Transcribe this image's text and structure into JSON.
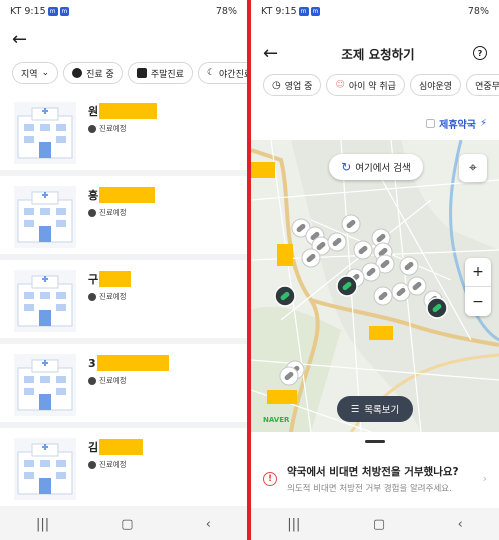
{
  "left": {
    "status": {
      "carrier": "KT 9:15",
      "battery": "78%"
    },
    "filters": [
      "지역",
      "진료 중",
      "주말진료",
      "야간진료"
    ],
    "items": [
      {
        "initial": "원",
        "status": "진료예정"
      },
      {
        "initial": "흥",
        "status": "진료예정"
      },
      {
        "initial": "구",
        "status": "진료예정"
      },
      {
        "initial": "3",
        "status": "진료예정"
      },
      {
        "initial": "김",
        "status": "진료예정"
      }
    ]
  },
  "right": {
    "status": {
      "carrier": "KT 9:15",
      "battery": "78%"
    },
    "title": "조제 요청하기",
    "help": "?",
    "filters": [
      "영업 중",
      "아이 약 취급",
      "심야운영",
      "연중무휴"
    ],
    "partner_label": "제휴약국",
    "search_here": "여기에서 검색",
    "list_view": "목록보기",
    "naver": "NAVER",
    "sheet": {
      "title": "약국에서 비대면 처방전을 거부했나요?",
      "subtitle": "의도적 비대면 처방전 거부 경험을 알려주세요."
    }
  },
  "colors": {
    "accent": "#2c5bd6",
    "divider": "#e3202a",
    "redaction": "#ffc000",
    "warn": "#e34a4a"
  }
}
